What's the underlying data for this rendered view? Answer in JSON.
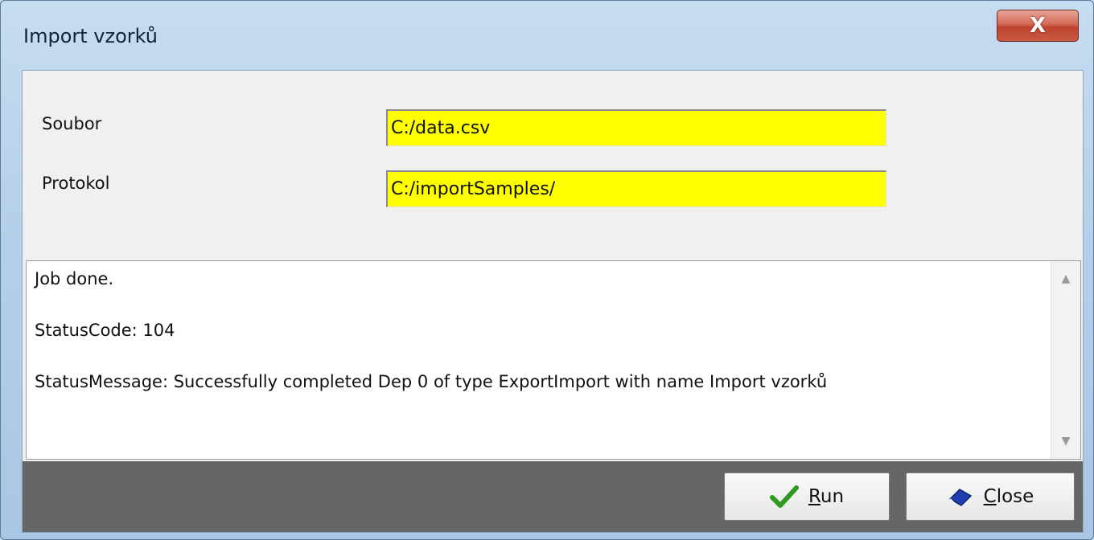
{
  "window": {
    "title": "Import vzorků",
    "close_glyph": "X",
    "close_icon": "close-icon"
  },
  "form": {
    "soubor_label": "Soubor",
    "soubor_value": "C:/data.csv",
    "protokol_label": "Protokol",
    "protokol_value": "C:/importSamples/",
    "field_highlight_color": "#ffff00"
  },
  "log": {
    "lines": [
      "Job done.",
      "StatusCode: 104",
      "StatusMessage: Successfully completed Dep 0 of type ExportImport with name Import vzorků"
    ],
    "scroll_up_icon": "scroll-up-arrow-icon",
    "scroll_down_icon": "scroll-down-arrow-icon"
  },
  "buttons": {
    "run": {
      "mnemonic": "R",
      "rest": "un",
      "icon": "checkmark-icon",
      "icon_color": "#2e9a1f"
    },
    "close": {
      "mnemonic": "C",
      "rest": "lose",
      "icon": "eraser-icon",
      "icon_color": "#1f3fae"
    }
  }
}
